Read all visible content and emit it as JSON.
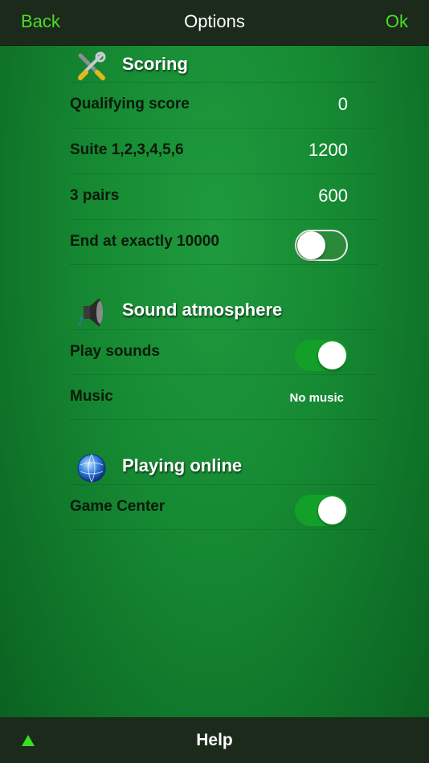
{
  "nav": {
    "back_label": "Back",
    "title": "Options",
    "ok_label": "Ok"
  },
  "scoring": {
    "title": "Scoring",
    "icon": "tools-icon",
    "rows": [
      {
        "label": "Qualifying score",
        "value": "0"
      },
      {
        "label": "Suite 1,2,3,4,5,6",
        "value": "1200"
      },
      {
        "label": "3 pairs",
        "value": "600"
      }
    ],
    "end_exact": {
      "label": "End at exactly 10000",
      "enabled": false
    }
  },
  "sound": {
    "title": "Sound atmosphere",
    "icon": "speaker-icon",
    "play_sounds": {
      "label": "Play sounds",
      "enabled": true
    },
    "music": {
      "label": "Music",
      "value": "No music"
    }
  },
  "online": {
    "title": "Playing online",
    "icon": "globe-icon",
    "game_center": {
      "label": "Game Center",
      "enabled": true
    }
  },
  "footer": {
    "help_label": "Help"
  },
  "colors": {
    "accent": "#4ddc2a",
    "toggle_on": "#12a028",
    "background": "#168a33"
  }
}
